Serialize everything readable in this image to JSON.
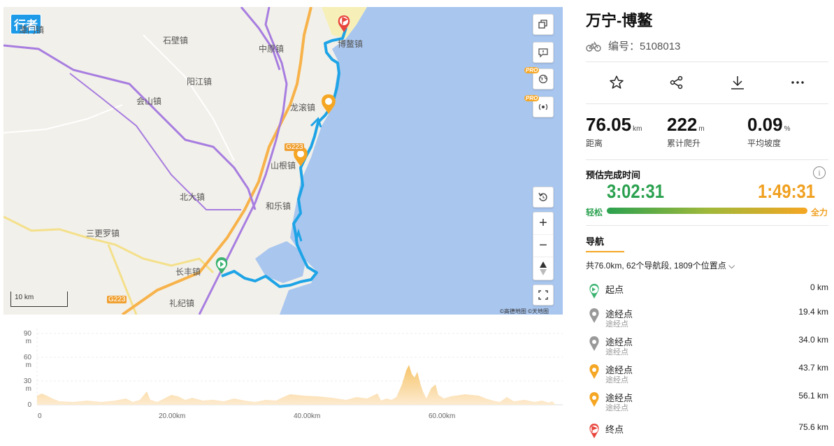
{
  "map": {
    "logo": "行者",
    "places": [
      {
        "name": "石壁镇"
      },
      {
        "name": "中原镇"
      },
      {
        "name": "阳江镇"
      },
      {
        "name": "会山镇"
      },
      {
        "name": "龙滚镇"
      },
      {
        "name": "山根镇"
      },
      {
        "name": "和乐镇"
      },
      {
        "name": "北大镇"
      },
      {
        "name": "三更罗镇"
      },
      {
        "name": "长丰镇"
      },
      {
        "name": "礼纪镇"
      },
      {
        "name": "潭门镇"
      },
      {
        "name": "博鳌镇"
      }
    ],
    "road_badges": [
      "G223",
      "G223"
    ],
    "pro_label": "PRO",
    "scale_label": "10 km",
    "copyright": "©高德地图  ©天地图",
    "controls": [
      "copy-icon",
      "feedback-icon",
      "globe-icon",
      "satellite-icon",
      "reset-icon",
      "zoom-in-icon",
      "zoom-out-icon",
      "compass-icon",
      "fullscreen-icon"
    ]
  },
  "elevation": {
    "y_labels": [
      "90 m",
      "60 m",
      "30 m",
      "0"
    ],
    "x_labels": [
      "0",
      "20.00km",
      "40.00km",
      "60.00km"
    ]
  },
  "route": {
    "title": "万宁-博鳌",
    "id_label": "编号：5108013",
    "stats": [
      {
        "value": "76.05",
        "unit": "km",
        "label": "距离"
      },
      {
        "value": "222",
        "unit": "m",
        "label": "累计爬升"
      },
      {
        "value": "0.09",
        "unit": "%",
        "label": "平均坡度"
      }
    ],
    "eta": {
      "title": "预估完成时间",
      "easy_time": "3:02:31",
      "full_time": "1:49:31",
      "easy_label": "轻松",
      "full_label": "全力"
    },
    "nav": {
      "tab": "导航",
      "summary": "共76.0km, 62个导航段, 1809个位置点 ⌵",
      "waypoints": [
        {
          "name": "起点",
          "sub": "",
          "dist": "0 km",
          "type": "start",
          "color": "#3cb371"
        },
        {
          "name": "途经点",
          "sub": "途经点",
          "dist": "19.4 km",
          "type": "via",
          "color": "#999999"
        },
        {
          "name": "途经点",
          "sub": "途经点",
          "dist": "34.0 km",
          "type": "via",
          "color": "#999999"
        },
        {
          "name": "途经点",
          "sub": "途经点",
          "dist": "43.7 km",
          "type": "via",
          "color": "#f5a623"
        },
        {
          "name": "途经点",
          "sub": "途经点",
          "dist": "56.1 km",
          "type": "via",
          "color": "#f5a623"
        },
        {
          "name": "终点",
          "sub": "",
          "dist": "75.6 km",
          "type": "end",
          "color": "#e8453c"
        }
      ]
    }
  },
  "colors": {
    "route": "#1ea4e6",
    "sea": "#a9c6ef",
    "land": "#f2f0ea",
    "accent": "#f5a623",
    "green": "#2ba14f"
  }
}
